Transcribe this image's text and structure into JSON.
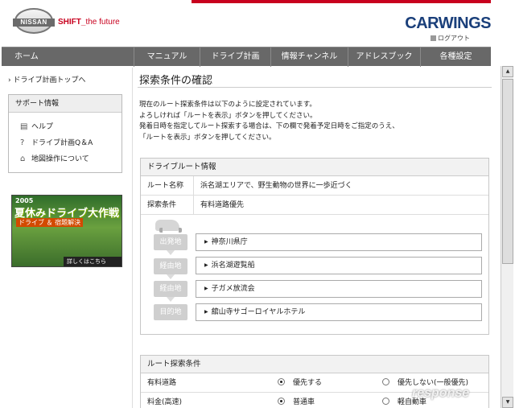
{
  "header": {
    "brand_top": "NISSAN",
    "slogan_bold": "SHIFT_",
    "slogan_thin": "the future",
    "service_name": "CARWINGS",
    "logout": "ログアウト"
  },
  "nav": [
    {
      "label": "ホーム"
    },
    {
      "label": "マニュアル"
    },
    {
      "label": "ドライブ計画"
    },
    {
      "label": "情報チャンネル"
    },
    {
      "label": "アドレスブック"
    },
    {
      "label": "各種設定"
    }
  ],
  "sidebar": {
    "top_link": "ドライブ計画トップへ",
    "support_title": "サポート情報",
    "links": [
      {
        "icon": "document-icon",
        "glyph": "▤",
        "label": "ヘルプ"
      },
      {
        "icon": "question-icon",
        "glyph": "?",
        "label": "ドライブ計画Q＆A"
      },
      {
        "icon": "mouse-icon",
        "glyph": "⌂",
        "label": "地図操作について"
      }
    ],
    "banner": {
      "year": "2005",
      "title": "夏休みドライブ大作戦",
      "subtitle": "ドライブ ＆ 宿題解決",
      "more": "詳しくはこちら"
    }
  },
  "main": {
    "title": "探索条件の確認",
    "intro": [
      "現在のルート探索条件は以下のように設定されています。",
      "よろしければ「ルートを表示」ボタンを押してください。",
      "発着日時を指定してルート探索する場合は、下の欄で発着予定日時をご指定のうえ、",
      "「ルートを表示」ボタンを押してください。"
    ],
    "route_info": {
      "title": "ドライブルート情報",
      "rows": [
        {
          "key": "ルート名称",
          "value": "浜名湖エリアで、野生動物の世界に一歩近づく"
        },
        {
          "key": "探索条件",
          "value": "有料道路優先"
        }
      ],
      "stops": [
        {
          "label": "出発地",
          "value": "神奈川県庁"
        },
        {
          "label": "経由地",
          "value": "浜名湖遊覧船"
        },
        {
          "label": "経由地",
          "value": "子ガメ放流会"
        },
        {
          "label": "目的地",
          "value": "舘山寺サゴーロイヤルホテル"
        }
      ]
    },
    "search_conditions": {
      "title": "ルート探索条件",
      "rows": [
        {
          "key": "有料道路",
          "opt1": "優先する",
          "opt1_selected": true,
          "opt2": "優先しない(一般優先)",
          "opt2_selected": false
        },
        {
          "key": "料金(高速)",
          "opt1": "普通車",
          "opt1_selected": true,
          "opt2": "軽自動車",
          "opt2_selected": false
        }
      ]
    }
  },
  "watermark": "response"
}
